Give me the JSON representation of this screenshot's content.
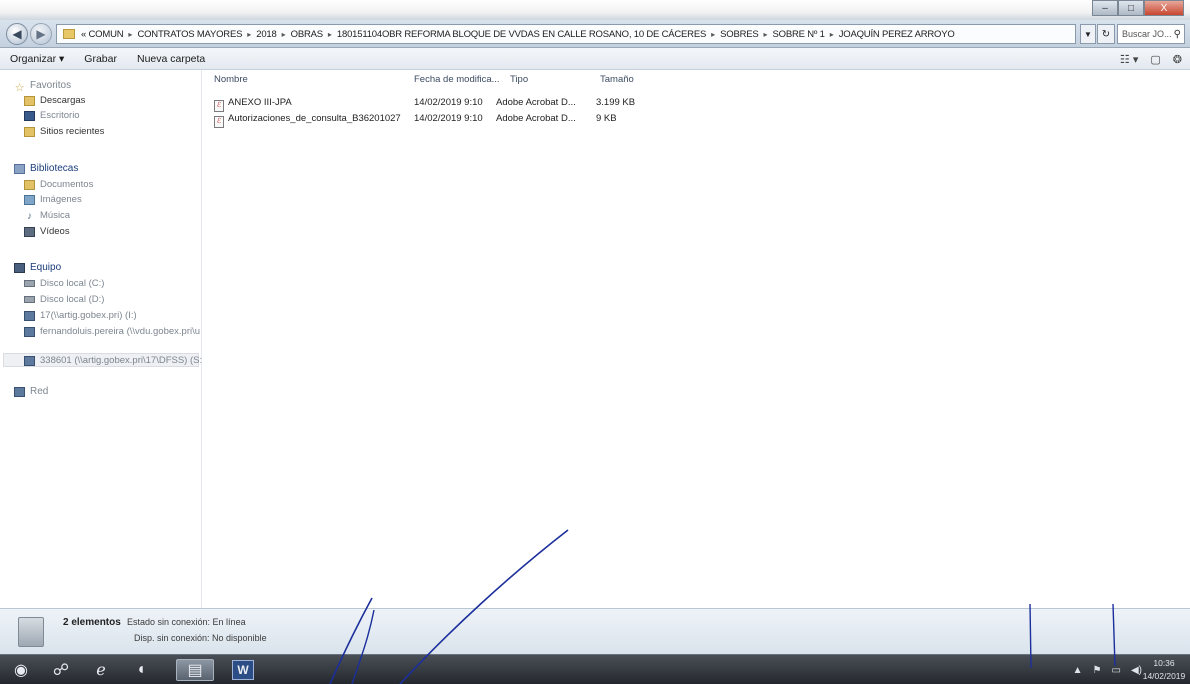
{
  "window": {
    "controls": [
      "–",
      "□",
      "X"
    ]
  },
  "address": {
    "breadcrumbs": [
      "« COMUN",
      "CONTRATOS MAYORES",
      "2018",
      "OBRAS",
      "180151104OBR REFORMA BLOQUE DE VVDAS EN CALLE ROSANO, 10 DE CÁCERES",
      "SOBRES",
      "SOBRE Nº 1",
      "JOAQUÍN PEREZ ARROYO"
    ],
    "separator": "▸",
    "search_placeholder": "Buscar JO..."
  },
  "toolbar": {
    "organize_label": "Organizar ▾",
    "burn_label": "Grabar",
    "new_folder_label": "Nueva carpeta"
  },
  "nav": {
    "favorites_header": "Favoritos",
    "favorites": [
      "Descargas",
      "Escritorio",
      "Sitios recientes"
    ],
    "libraries_header": "Bibliotecas",
    "libraries": [
      "Documentos",
      "Imágenes",
      "Música",
      "Vídeos"
    ],
    "computer_header": "Equipo",
    "drives": [
      "Disco local (C:)",
      "Disco local (D:)",
      "17(\\\\artig.gobex.pri) (I:)",
      "fernandoluis.pereira (\\\\vdu.gobex.pri\\u",
      "338601 (\\\\artig.gobex.pri\\17\\DFSS) (S:"
    ],
    "network_header": "Red"
  },
  "files": {
    "columns": [
      "Nombre",
      "Fecha de modifica...",
      "Tipo",
      "Tamaño"
    ],
    "rows": [
      {
        "name": "ANEXO III-JPA",
        "modified": "14/02/2019 9:10",
        "type": "Adobe Acrobat D...",
        "size": "3.199 KB"
      },
      {
        "name": "Autorizaciones_de_consulta_B36201027",
        "modified": "14/02/2019 9:10",
        "type": "Adobe Acrobat D...",
        "size": "9 KB"
      }
    ]
  },
  "status": {
    "count": "2 elementos",
    "offline_status": "Estado sin conexión: En línea",
    "offline_availability": "Disp. sin conexión: No disponible"
  },
  "taskbar": {
    "word_label": "W",
    "tray": [
      "▲",
      "⚑",
      "▭",
      "◀)"
    ],
    "time": "10:36",
    "date": "14/02/2019"
  }
}
